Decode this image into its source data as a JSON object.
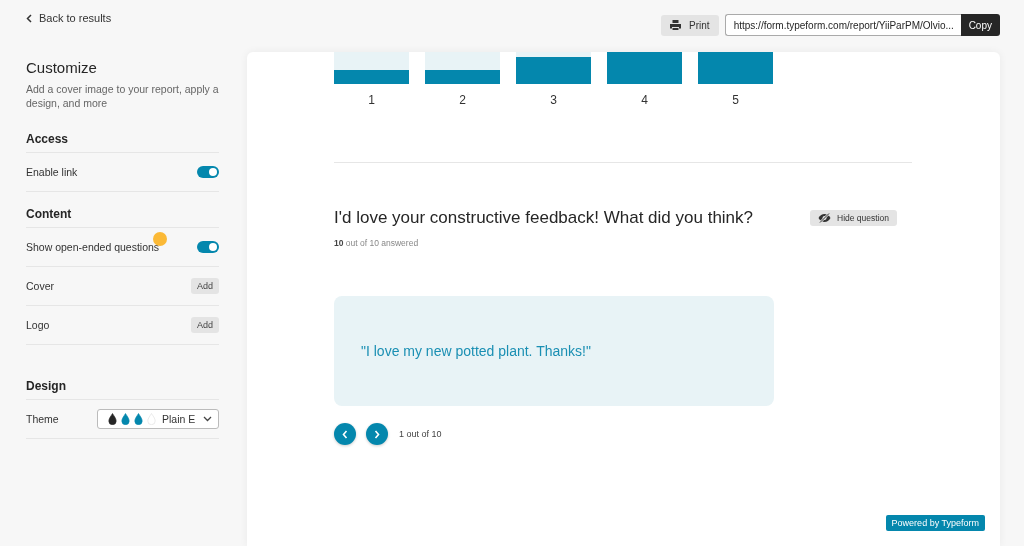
{
  "back_link": "Back to results",
  "sidebar": {
    "title": "Customize",
    "description": "Add a cover image to your report, apply a design, and more",
    "sections": [
      {
        "heading": "Access",
        "rows": [
          {
            "kind": "toggle",
            "label": "Enable link",
            "on": true
          }
        ]
      },
      {
        "heading": "Content",
        "rows": [
          {
            "kind": "toggle",
            "label": "Show open-ended questions",
            "on": true
          },
          {
            "kind": "add",
            "label": "Cover",
            "button": "Add"
          },
          {
            "kind": "add",
            "label": "Logo",
            "button": "Add"
          }
        ]
      },
      {
        "heading": "Design",
        "rows": [
          {
            "kind": "theme",
            "label": "Theme",
            "value": "Plain E",
            "swatches": [
              {
                "color": "#262626"
              },
              {
                "color": "#0487ad"
              },
              {
                "color": "#0487ad"
              },
              {
                "color": "#ffffff"
              }
            ]
          }
        ]
      }
    ]
  },
  "toolbar": {
    "print": "Print",
    "url": "https://form.typeform.com/report/YiiParPM/Olvio...",
    "copy": "Copy"
  },
  "rating_bars": [
    {
      "label": "1"
    },
    {
      "label": "2"
    },
    {
      "label": "3"
    },
    {
      "label": "4"
    },
    {
      "label": "5"
    }
  ],
  "question": {
    "title": "I'd love your constructive feedback! What did you think?",
    "answered": "**10** out of 10 answered",
    "hide_button": "Hide question",
    "answer": "\"I love my new potted plant. Thanks!\"",
    "pager": "1 out of 10"
  },
  "badge": "Powered by Typeform"
}
